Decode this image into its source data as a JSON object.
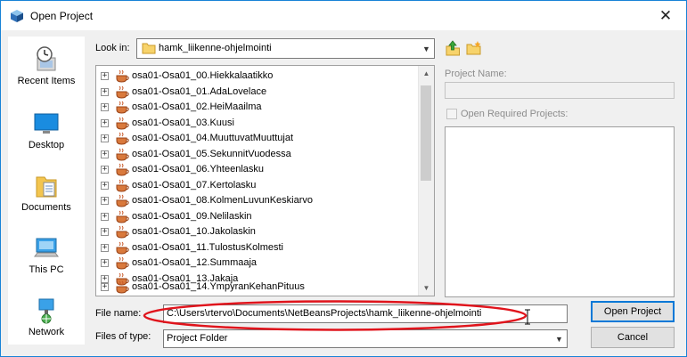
{
  "window": {
    "title": "Open Project",
    "close_glyph": "✕"
  },
  "sidebar": {
    "places": [
      {
        "label": "Recent Items",
        "icon": "recent-items-icon"
      },
      {
        "label": "Desktop",
        "icon": "desktop-icon"
      },
      {
        "label": "Documents",
        "icon": "documents-icon"
      },
      {
        "label": "This PC",
        "icon": "this-pc-icon"
      },
      {
        "label": "Network",
        "icon": "network-icon"
      }
    ]
  },
  "look_in": {
    "label": "Look in:",
    "value": "hamk_liikenne-ohjelmointi"
  },
  "files": [
    "osa01-Osa01_00.Hiekkalaatikko",
    "osa01-Osa01_01.AdaLovelace",
    "osa01-Osa01_02.HeiMaailma",
    "osa01-Osa01_03.Kuusi",
    "osa01-Osa01_04.MuuttuvatMuuttujat",
    "osa01-Osa01_05.SekunnitVuodessa",
    "osa01-Osa01_06.Yhteenlasku",
    "osa01-Osa01_07.Kertolasku",
    "osa01-Osa01_08.KolmenLuvunKeskiarvo",
    "osa01-Osa01_09.Nelilaskin",
    "osa01-Osa01_10.Jakolaskin",
    "osa01-Osa01_11.TulostusKolmesti",
    "osa01-Osa01_12.Summaaja",
    "osa01-Osa01_13.Jakaja",
    "osa01-Osa01_14.YmpyranKehanPituus"
  ],
  "right_panel": {
    "project_name_label": "Project Name:",
    "project_name_value": "",
    "open_required_label": "Open Required Projects:"
  },
  "file_name": {
    "label": "File name:",
    "value": "C:\\Users\\rtervo\\Documents\\NetBeansProjects\\hamk_liikenne-ohjelmointi"
  },
  "file_type": {
    "label": "Files of type:",
    "value": "Project Folder"
  },
  "buttons": {
    "open": "Open Project",
    "cancel": "Cancel"
  },
  "colors": {
    "accent": "#0078d7",
    "annotation": "#e0141c",
    "folder": "#f7d36b"
  }
}
